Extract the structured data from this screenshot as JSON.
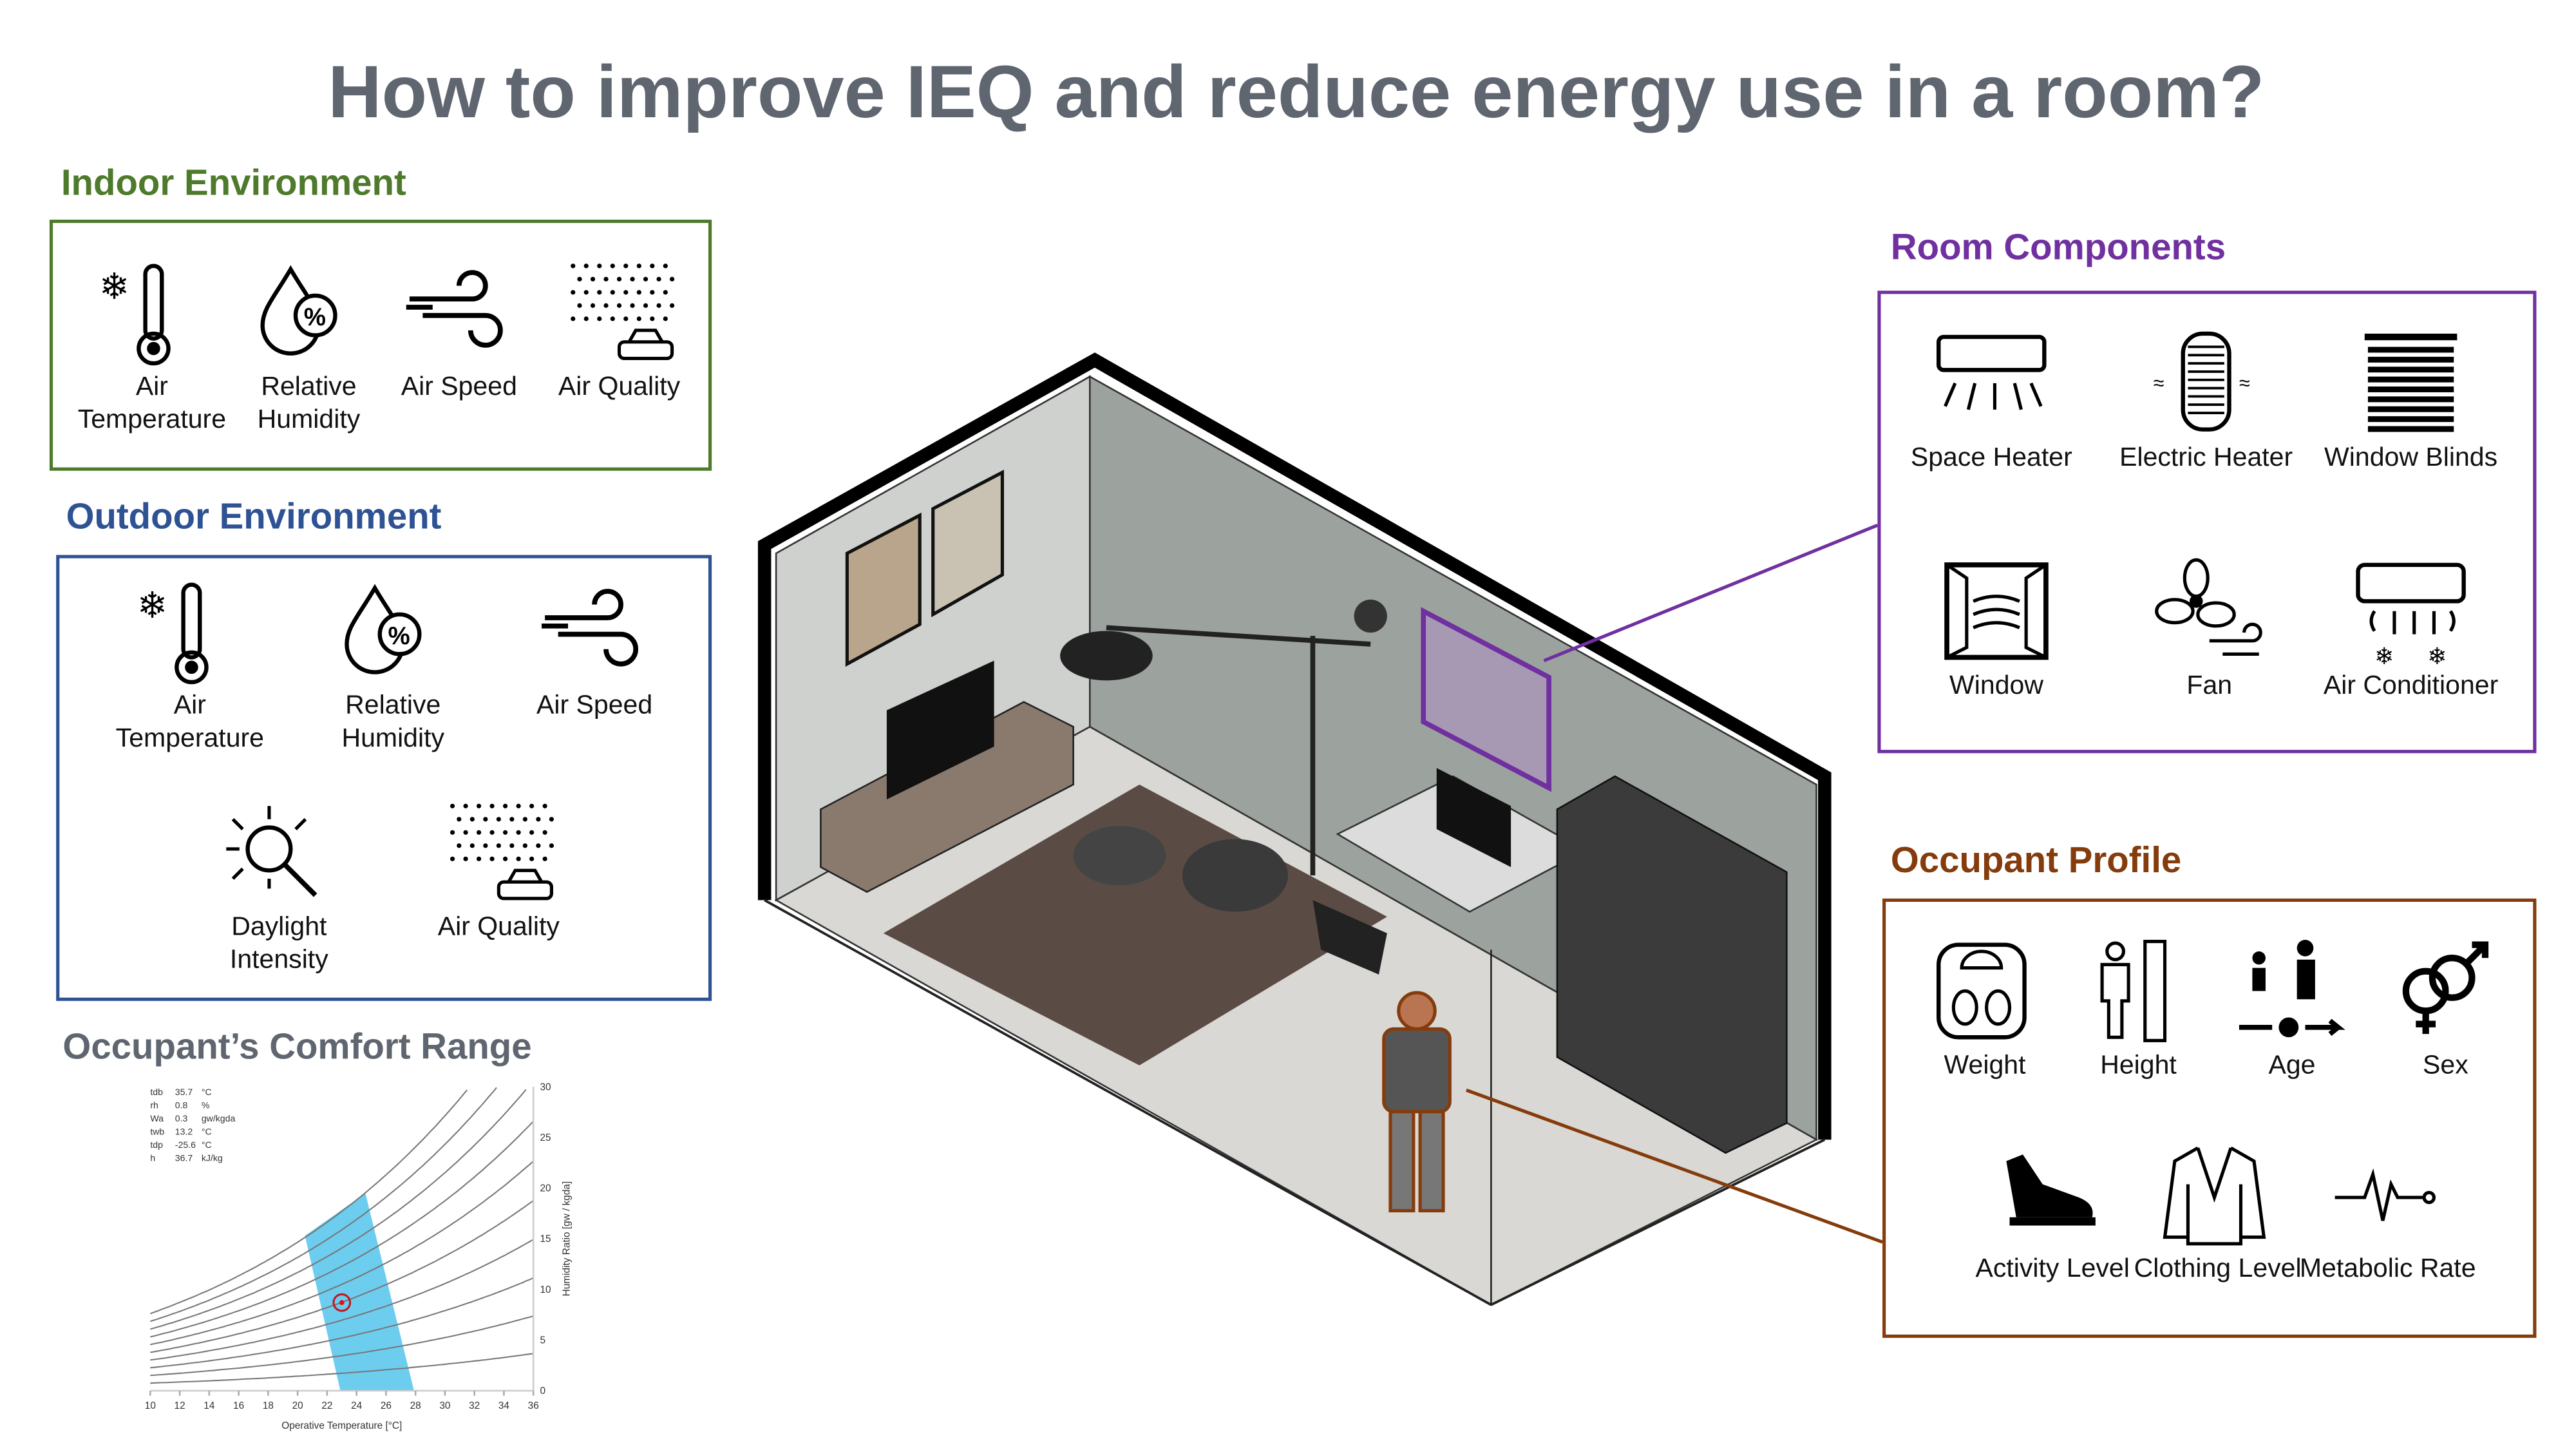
{
  "title": "How to improve IEQ and reduce energy use in a room?",
  "colors": {
    "indoor": "#4e7a2b",
    "outdoor": "#2e5293",
    "comfort": "#5f6670",
    "room": "#7030a0",
    "occupant": "#843c0c",
    "comfort_zone": "#6dcdef",
    "point": "#e0101a"
  },
  "indoor": {
    "heading": "Indoor Environment",
    "items": [
      {
        "icon": "thermometer-snowflake-icon",
        "label": "Air Temperature"
      },
      {
        "icon": "humidity-drop-icon",
        "label": "Relative Humidity"
      },
      {
        "icon": "wind-icon",
        "label": "Air Speed"
      },
      {
        "icon": "air-quality-car-icon",
        "label": "Air Quality"
      }
    ]
  },
  "outdoor": {
    "heading": "Outdoor Environment",
    "items": [
      {
        "icon": "thermometer-snowflake-icon",
        "label": "Air Temperature"
      },
      {
        "icon": "humidity-drop-icon",
        "label": "Relative Humidity"
      },
      {
        "icon": "wind-icon",
        "label": "Air Speed"
      },
      {
        "icon": "sun-magnifier-icon",
        "label": "Daylight Intensity"
      },
      {
        "icon": "air-quality-car-icon",
        "label": "Air Quality"
      }
    ]
  },
  "comfort": {
    "heading": "Occupant’s Comfort Range"
  },
  "room_components": {
    "heading": "Room Components",
    "items": [
      {
        "icon": "space-heater-icon",
        "label": "Space Heater"
      },
      {
        "icon": "electric-heater-icon",
        "label": "Electric Heater"
      },
      {
        "icon": "window-blinds-icon",
        "label": "Window Blinds"
      },
      {
        "icon": "window-icon",
        "label": "Window"
      },
      {
        "icon": "fan-icon",
        "label": "Fan"
      },
      {
        "icon": "air-conditioner-icon",
        "label": "Air Conditioner"
      }
    ]
  },
  "occupant": {
    "heading": "Occupant Profile",
    "items": [
      {
        "icon": "weight-scale-icon",
        "label": "Weight"
      },
      {
        "icon": "height-ruler-icon",
        "label": "Height"
      },
      {
        "icon": "age-icon",
        "label": "Age"
      },
      {
        "icon": "sex-symbol-icon",
        "label": "Sex"
      },
      {
        "icon": "shoe-icon",
        "label": "Activity Level"
      },
      {
        "icon": "jacket-icon",
        "label": "Clothing Level"
      },
      {
        "icon": "heartbeat-icon",
        "label": "Metabolic Rate"
      }
    ]
  },
  "chart_data": {
    "type": "line",
    "title": "",
    "xlabel": "Operative Temperature [°C]",
    "ylabel": "Humidity Ratio [gw / kgda]",
    "xlim": [
      10,
      36
    ],
    "ylim": [
      0,
      30
    ],
    "xticks": [
      10,
      12,
      14,
      16,
      18,
      20,
      22,
      24,
      26,
      28,
      30,
      32,
      34,
      36
    ],
    "yticks": [
      0,
      5,
      10,
      15,
      20,
      25,
      30
    ],
    "rh_curves_percent": [
      10,
      20,
      30,
      40,
      50,
      60,
      70,
      80,
      90,
      100
    ],
    "comfort_zone": [
      [
        20.5,
        15.3
      ],
      [
        24.6,
        19.5
      ],
      [
        27.9,
        0
      ],
      [
        22.9,
        0
      ]
    ],
    "point": [
      23,
      8.7
    ],
    "readout": [
      {
        "name": "tdb",
        "value": "35.7",
        "unit": "°C"
      },
      {
        "name": "rh",
        "value": "0.8",
        "unit": "%"
      },
      {
        "name": "Wa",
        "value": "0.3",
        "unit": "gw/kgda"
      },
      {
        "name": "twb",
        "value": "13.2",
        "unit": "°C"
      },
      {
        "name": "tdp",
        "value": "-25.6",
        "unit": "°C"
      },
      {
        "name": "h",
        "value": "36.7",
        "unit": "kJ/kg"
      }
    ]
  }
}
